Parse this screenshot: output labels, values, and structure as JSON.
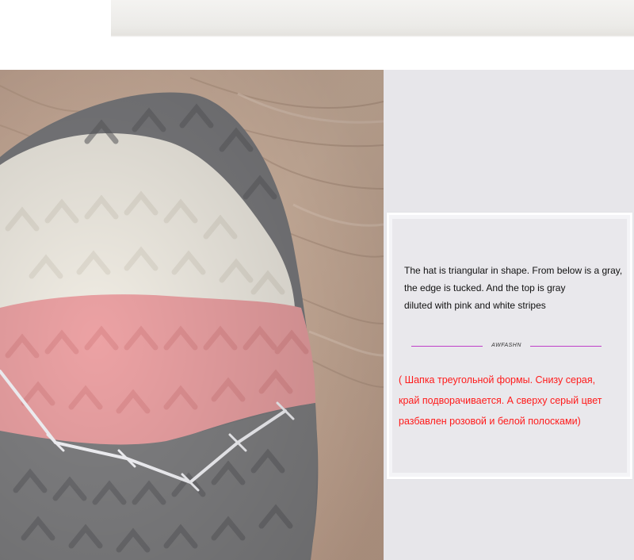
{
  "description_en": {
    "lines": [
      "The hat is triangular in shape. From below is a gray,",
      "the edge is tucked. And the top is gray",
      "diluted with pink and white stripes"
    ]
  },
  "brand": "AWFASHN",
  "description_ru": {
    "lines": [
      "( Шапка треугольной формы.  Снизу серая,",
      "край подворачивается. А сверху серый цвет",
      "разбавлен розовой и белой полосками)"
    ]
  },
  "colors": {
    "panel_bg": "#e7e6ea",
    "divider": "#c040c8",
    "ru_text": "#ff1a1a",
    "knit_gray": "#7d7d7f",
    "knit_white": "#f4f1ea",
    "knit_pink": "#eda3a5",
    "fabric_tan": "#d2b59f"
  }
}
